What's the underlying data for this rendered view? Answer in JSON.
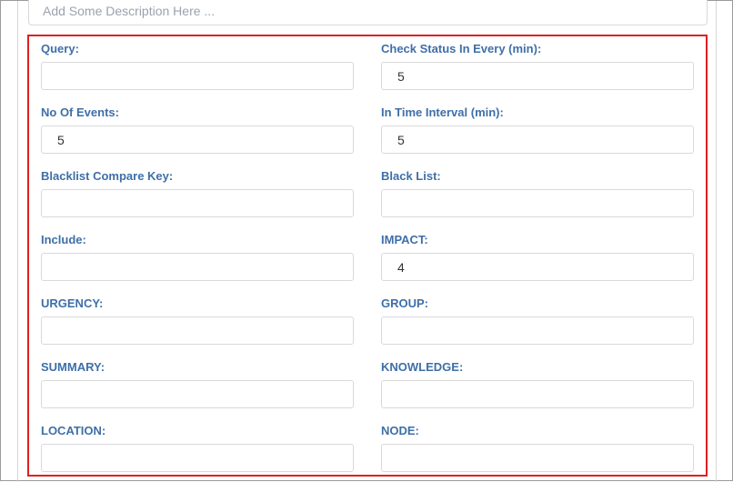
{
  "description": {
    "placeholder": "Add Some Description Here ...",
    "value": ""
  },
  "form": {
    "query": {
      "label": "Query:",
      "value": ""
    },
    "check_status": {
      "label": "Check Status In Every (min):",
      "value": "5"
    },
    "no_of_events": {
      "label": "No Of Events:",
      "value": "5"
    },
    "time_interval": {
      "label": "In Time Interval (min):",
      "value": "5"
    },
    "blacklist_compare_key": {
      "label": "Blacklist Compare Key:",
      "value": ""
    },
    "black_list": {
      "label": "Black List:",
      "value": ""
    },
    "include": {
      "label": "Include:",
      "value": ""
    },
    "impact": {
      "label": "IMPACT:",
      "value": "4"
    },
    "urgency": {
      "label": "URGENCY:",
      "value": ""
    },
    "group": {
      "label": "GROUP:",
      "value": ""
    },
    "summary": {
      "label": "SUMMARY:",
      "value": ""
    },
    "knowledge": {
      "label": "KNOWLEDGE:",
      "value": ""
    },
    "location": {
      "label": "LOCATION:",
      "value": ""
    },
    "node": {
      "label": "NODE:",
      "value": ""
    }
  },
  "colors": {
    "label": "#3e6fa8",
    "highlight_border": "#e02020",
    "input_border": "#d9d9d9"
  }
}
